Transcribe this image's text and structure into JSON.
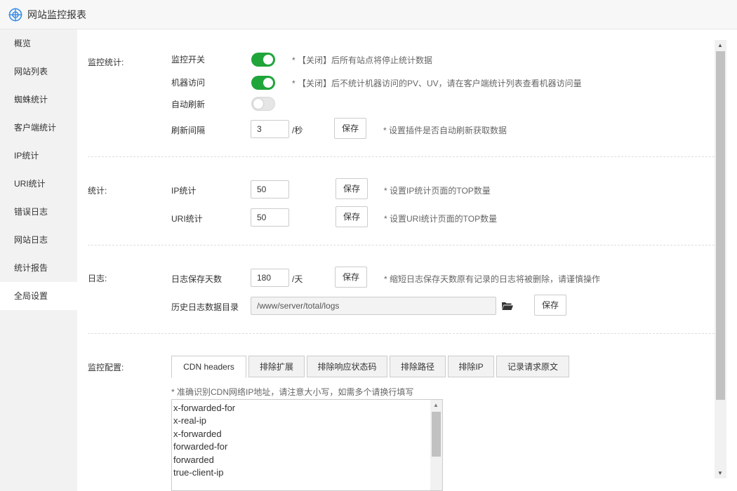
{
  "window": {
    "title": "网站监控报表"
  },
  "sidebar": {
    "items": [
      {
        "label": "概览"
      },
      {
        "label": "网站列表"
      },
      {
        "label": "蜘蛛统计"
      },
      {
        "label": "客户端统计"
      },
      {
        "label": "IP统计"
      },
      {
        "label": "URI统计"
      },
      {
        "label": "错误日志"
      },
      {
        "label": "网站日志"
      },
      {
        "label": "统计报告"
      },
      {
        "label": "全局设置",
        "active": true
      }
    ]
  },
  "monitor": {
    "section_label": "监控统计:",
    "switch_label": "监控开关",
    "switch_state": "on",
    "switch_hint": "* 【关闭】后所有站点将停止统计数据",
    "robot_label": "机器访问",
    "robot_state": "on",
    "robot_hint": "* 【关闭】后不统计机器访问的PV、UV，请在客户端统计列表查看机器访问量",
    "auto_label": "自动刷新",
    "auto_state": "off",
    "interval_label": "刷新间隔",
    "interval_value": "3",
    "interval_unit": "/秒",
    "save_label": "保存",
    "interval_hint": "* 设置插件是否自动刷新获取数据"
  },
  "stats": {
    "section_label": "统计:",
    "ip_label": "IP统计",
    "ip_value": "50",
    "ip_hint": "* 设置IP统计页面的TOP数量",
    "uri_label": "URI统计",
    "uri_value": "50",
    "uri_hint": "* 设置URI统计页面的TOP数量",
    "save_label": "保存"
  },
  "logs": {
    "section_label": "日志:",
    "days_label": "日志保存天数",
    "days_value": "180",
    "days_unit": "/天",
    "days_hint": "* 缩短日志保存天数原有记录的日志将被删除，请谨慎操作",
    "dir_label": "历史日志数据目录",
    "dir_value": "/www/server/total/logs",
    "save_label": "保存",
    "folder_icon": "folder-open-icon"
  },
  "config": {
    "section_label": "监控配置:",
    "tabs": [
      {
        "label": "CDN headers",
        "active": true
      },
      {
        "label": "排除扩展"
      },
      {
        "label": "排除响应状态码"
      },
      {
        "label": "排除路径"
      },
      {
        "label": "排除IP"
      },
      {
        "label": "记录请求原文"
      }
    ],
    "hint": "* 准确识别CDN网络IP地址，请注意大小写，如需多个请换行填写",
    "textarea_lines": [
      "x-forwarded-for",
      "x-real-ip",
      "x-forwarded",
      "forwarded-for",
      "forwarded",
      "true-client-ip"
    ]
  },
  "colors": {
    "accent": "#20a53a",
    "sidebar_bg": "#f2f2f2"
  }
}
